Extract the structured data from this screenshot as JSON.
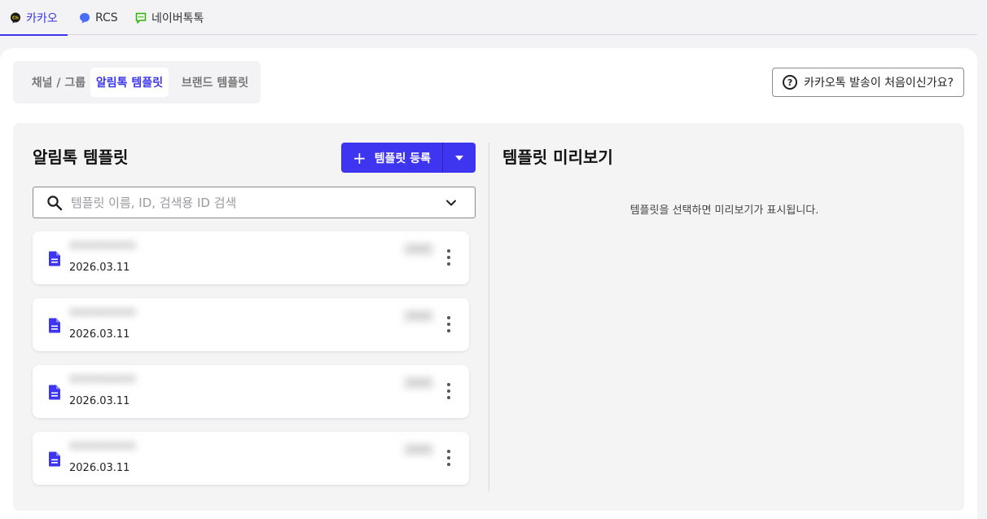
{
  "channel_tabs": [
    {
      "label": "카카오",
      "icon": "kakao-channel-icon",
      "active": true
    },
    {
      "label": "RCS",
      "icon": "rcs-bubble-icon",
      "active": false
    },
    {
      "label": "네이버톡톡",
      "icon": "naver-talk-icon",
      "active": false
    }
  ],
  "sub_tabs": [
    {
      "label": "채널 / 그룹",
      "active": false
    },
    {
      "label": "알림톡 템플릿",
      "active": true
    },
    {
      "label": "브랜드 템플릿",
      "active": false
    }
  ],
  "help_button": {
    "label": "카카오톡 발송이 처음이신가요?",
    "icon": "question-circle-icon"
  },
  "left_panel": {
    "title": "알림톡 템플릿",
    "register_label": "템플릿 등록",
    "search": {
      "placeholder": "템플릿 이름, ID, 검색용 ID 검색",
      "value": ""
    }
  },
  "templates": [
    {
      "name": "OOOOOOOO",
      "date": "2026.03.11",
      "status": "OOO"
    },
    {
      "name": "OOOOOOOO",
      "date": "2026.03.11",
      "status": "OOO"
    },
    {
      "name": "OOOOOOOO",
      "date": "2026.03.11",
      "status": "OOO"
    },
    {
      "name": "OOOOOOOO",
      "date": "2026.03.11",
      "status": "OOO"
    }
  ],
  "right_panel": {
    "title": "템플릿 미리보기",
    "empty_message": "템플릿을 선택하면 미리보기가 표시됩니다."
  },
  "colors": {
    "accent": "#3d35f0",
    "panel_bg": "#f4f4f5",
    "page_bg": "#f3f3f5"
  }
}
